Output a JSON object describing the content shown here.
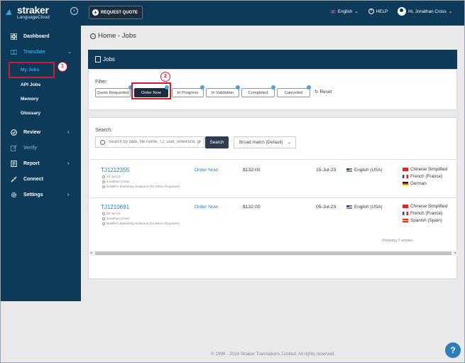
{
  "topbar": {
    "logo_name": "straker",
    "logo_sub": "LanguageCloud",
    "request_quote": "REQUEST QUOTE",
    "language": "English",
    "help": "HELP",
    "user": "Hi, Jonathan Cross"
  },
  "sidebar": {
    "dashboard": "Dashboard",
    "translate": "Translate",
    "my_jobs": "My Jobs",
    "api_jobs": "API Jobs",
    "memory": "Memory",
    "glossary": "Glossary",
    "review": "Review",
    "verify": "Verify",
    "report": "Report",
    "connect": "Connect",
    "settings": "Settings"
  },
  "annotations": {
    "step1": "1",
    "step2": "2"
  },
  "main": {
    "breadcrumb": "Home - Jobs",
    "jobs_title": "Jobs",
    "filter_label": "Filter:",
    "filters": {
      "quote_requested": "Quote Requested",
      "order_now": "Order Now",
      "in_progress": "In Progress",
      "in_validation": "In Validation",
      "completed": "Completed",
      "cancelled": "Cancelled"
    },
    "reset": "Reset",
    "search_label": "Search:",
    "search_placeholder": "Search by date, file name, TJ, user, reference, glossary",
    "search_button": "Search",
    "match_option": "Broad match (Default)",
    "rows": [
      {
        "id": "TJ1212355",
        "date_small": "13-Jul-23",
        "user": "Jonathan Cross",
        "company": "BuildPro Marketing Solutions (for Demo Purposes)",
        "status": "Order Now",
        "price": "$132.00",
        "due": "15-Jul-23",
        "source": "English (USA)",
        "targets": [
          "Chinese Simplified",
          "French (France)",
          "German"
        ]
      },
      {
        "id": "TJ1210691",
        "date_small": "03-Jul-23",
        "user": "Jonathan Cross",
        "company": "BuildPro Marketing Solutions (for Demo Purposes)",
        "status": "Order Now",
        "price": "$132.00",
        "due": "05-Jul-23",
        "source": "English (USA)",
        "targets": [
          "Chinese Simplified",
          "French (France)",
          "Spanish (Spain)"
        ]
      }
    ],
    "showing": "Showing 2 entries",
    "footer": "© 1999 - 2024 Straker Translations Limited. All rights reserved."
  },
  "help_fab": "?"
}
